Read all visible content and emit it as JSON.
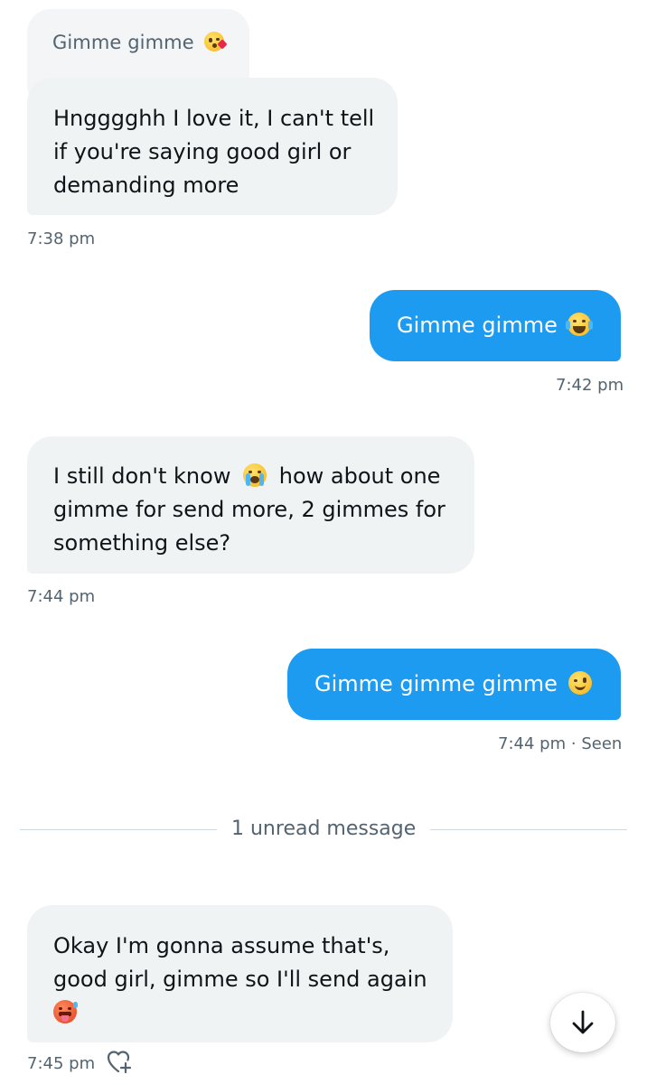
{
  "conversation": {
    "quoted_message": {
      "text": "Gimme gimme",
      "emoji": "kissing-face-heart-emoji"
    },
    "messages": [
      {
        "direction": "in",
        "lines": [
          "Hngggghh I love it, I can't tell",
          "if you're saying good girl or",
          "demanding more"
        ],
        "time": "7:38 pm"
      },
      {
        "direction": "out",
        "text": "Gimme gimme",
        "emoji": "laughing-tears-emoji",
        "time": "7:42 pm"
      },
      {
        "direction": "in",
        "line1_before": "I still don't know",
        "line1_after": "how about one",
        "line2": "gimme for send more, 2 gimmes for",
        "line3": "something else?",
        "emoji": "loudly-crying-emoji",
        "time": "7:44 pm"
      },
      {
        "direction": "out",
        "text": "Gimme gimme gimme",
        "emoji": "winking-face-emoji",
        "time": "7:44 pm",
        "status": "Seen",
        "separator": "·"
      },
      {
        "direction": "in",
        "lines": [
          "Okay I'm gonna assume that's,",
          "good girl, gimme so I'll send again"
        ],
        "emoji": "hot-face-emoji",
        "time": "7:45 pm"
      }
    ],
    "unread_divider": "1 unread message"
  },
  "colors": {
    "outgoing_bubble": "#1d9bf0",
    "incoming_bubble": "#eff3f4",
    "secondary_text": "#536471"
  },
  "icons": {
    "react": "heart-plus-icon",
    "scroll_down": "arrow-down-icon"
  }
}
